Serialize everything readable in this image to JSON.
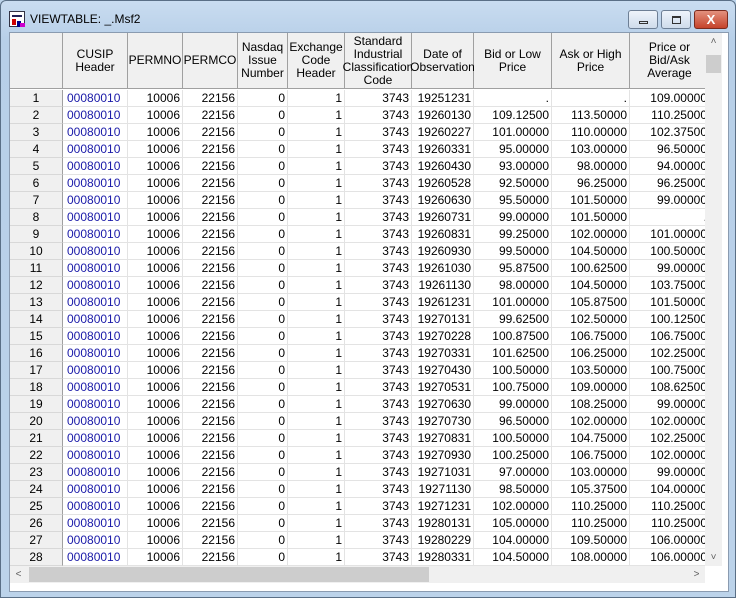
{
  "window": {
    "title": "VIEWTABLE: _.Msf2",
    "minimize": "—",
    "maximize": "□",
    "close": "X"
  },
  "columns": [
    "CUSIP Header",
    "PERMNO",
    "PERMCO",
    "Nasdaq Issue Number",
    "Exchange Code Header",
    "Standard Industrial Classification Code",
    "Date of Observation",
    "Bid or Low Price",
    "Ask or High Price",
    "Price or Bid/Ask Average"
  ],
  "rows": [
    [
      "1",
      "00080010",
      "10006",
      "22156",
      "0",
      "1",
      "3743",
      "19251231",
      ".",
      ".",
      "109.00000"
    ],
    [
      "2",
      "00080010",
      "10006",
      "22156",
      "0",
      "1",
      "3743",
      "19260130",
      "109.12500",
      "113.50000",
      "110.25000"
    ],
    [
      "3",
      "00080010",
      "10006",
      "22156",
      "0",
      "1",
      "3743",
      "19260227",
      "101.00000",
      "110.00000",
      "102.37500"
    ],
    [
      "4",
      "00080010",
      "10006",
      "22156",
      "0",
      "1",
      "3743",
      "19260331",
      "95.00000",
      "103.00000",
      "96.50000"
    ],
    [
      "5",
      "00080010",
      "10006",
      "22156",
      "0",
      "1",
      "3743",
      "19260430",
      "93.00000",
      "98.00000",
      "94.00000"
    ],
    [
      "6",
      "00080010",
      "10006",
      "22156",
      "0",
      "1",
      "3743",
      "19260528",
      "92.50000",
      "96.25000",
      "96.25000"
    ],
    [
      "7",
      "00080010",
      "10006",
      "22156",
      "0",
      "1",
      "3743",
      "19260630",
      "95.50000",
      "101.50000",
      "99.00000"
    ],
    [
      "8",
      "00080010",
      "10006",
      "22156",
      "0",
      "1",
      "3743",
      "19260731",
      "99.00000",
      "101.50000",
      "."
    ],
    [
      "9",
      "00080010",
      "10006",
      "22156",
      "0",
      "1",
      "3743",
      "19260831",
      "99.25000",
      "102.00000",
      "101.00000"
    ],
    [
      "10",
      "00080010",
      "10006",
      "22156",
      "0",
      "1",
      "3743",
      "19260930",
      "99.50000",
      "104.50000",
      "100.50000"
    ],
    [
      "11",
      "00080010",
      "10006",
      "22156",
      "0",
      "1",
      "3743",
      "19261030",
      "95.87500",
      "100.62500",
      "99.00000"
    ],
    [
      "12",
      "00080010",
      "10006",
      "22156",
      "0",
      "1",
      "3743",
      "19261130",
      "98.00000",
      "104.50000",
      "103.75000"
    ],
    [
      "13",
      "00080010",
      "10006",
      "22156",
      "0",
      "1",
      "3743",
      "19261231",
      "101.00000",
      "105.87500",
      "101.50000"
    ],
    [
      "14",
      "00080010",
      "10006",
      "22156",
      "0",
      "1",
      "3743",
      "19270131",
      "99.62500",
      "102.50000",
      "100.12500"
    ],
    [
      "15",
      "00080010",
      "10006",
      "22156",
      "0",
      "1",
      "3743",
      "19270228",
      "100.87500",
      "106.75000",
      "106.75000"
    ],
    [
      "16",
      "00080010",
      "10006",
      "22156",
      "0",
      "1",
      "3743",
      "19270331",
      "101.62500",
      "106.25000",
      "102.25000"
    ],
    [
      "17",
      "00080010",
      "10006",
      "22156",
      "0",
      "1",
      "3743",
      "19270430",
      "100.50000",
      "103.50000",
      "100.75000"
    ],
    [
      "18",
      "00080010",
      "10006",
      "22156",
      "0",
      "1",
      "3743",
      "19270531",
      "100.75000",
      "109.00000",
      "108.62500"
    ],
    [
      "19",
      "00080010",
      "10006",
      "22156",
      "0",
      "1",
      "3743",
      "19270630",
      "99.00000",
      "108.25000",
      "99.00000"
    ],
    [
      "20",
      "00080010",
      "10006",
      "22156",
      "0",
      "1",
      "3743",
      "19270730",
      "96.50000",
      "102.00000",
      "102.00000"
    ],
    [
      "21",
      "00080010",
      "10006",
      "22156",
      "0",
      "1",
      "3743",
      "19270831",
      "100.50000",
      "104.75000",
      "102.25000"
    ],
    [
      "22",
      "00080010",
      "10006",
      "22156",
      "0",
      "1",
      "3743",
      "19270930",
      "100.25000",
      "106.75000",
      "102.00000"
    ],
    [
      "23",
      "00080010",
      "10006",
      "22156",
      "0",
      "1",
      "3743",
      "19271031",
      "97.00000",
      "103.00000",
      "99.00000"
    ],
    [
      "24",
      "00080010",
      "10006",
      "22156",
      "0",
      "1",
      "3743",
      "19271130",
      "98.50000",
      "105.37500",
      "104.00000"
    ],
    [
      "25",
      "00080010",
      "10006",
      "22156",
      "0",
      "1",
      "3743",
      "19271231",
      "102.00000",
      "110.25000",
      "110.25000"
    ],
    [
      "26",
      "00080010",
      "10006",
      "22156",
      "0",
      "1",
      "3743",
      "19280131",
      "105.00000",
      "110.25000",
      "110.25000"
    ],
    [
      "27",
      "00080010",
      "10006",
      "22156",
      "0",
      "1",
      "3743",
      "19280229",
      "104.00000",
      "109.50000",
      "106.00000"
    ],
    [
      "28",
      "00080010",
      "10006",
      "22156",
      "0",
      "1",
      "3743",
      "19280331",
      "104.50000",
      "108.00000",
      "106.00000"
    ]
  ],
  "scroll": {
    "up": "˄",
    "down": "˅",
    "left": "<",
    "right": ">"
  }
}
